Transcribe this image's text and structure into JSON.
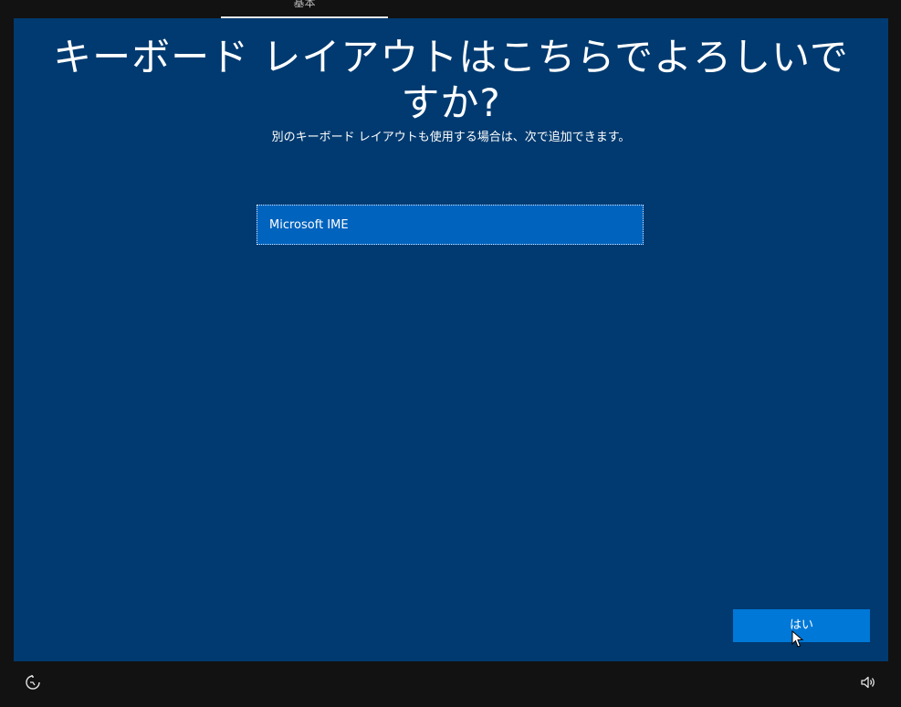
{
  "top_tab": {
    "label": "基本"
  },
  "main": {
    "title": "キーボード レイアウトはこちらでよろしいですか?",
    "subtitle": "別のキーボード レイアウトも使用する場合は、次で追加できます。",
    "options": [
      {
        "label": "Microsoft IME",
        "selected": true
      }
    ],
    "yes_button_label": "はい"
  },
  "footer": {
    "left_icon": "ease-of-access-icon",
    "right_icon": "volume-icon"
  },
  "colors": {
    "background_panel": "#003a70",
    "selected_item": "#0063be",
    "primary_button": "#0078d7",
    "frame": "#121212"
  }
}
